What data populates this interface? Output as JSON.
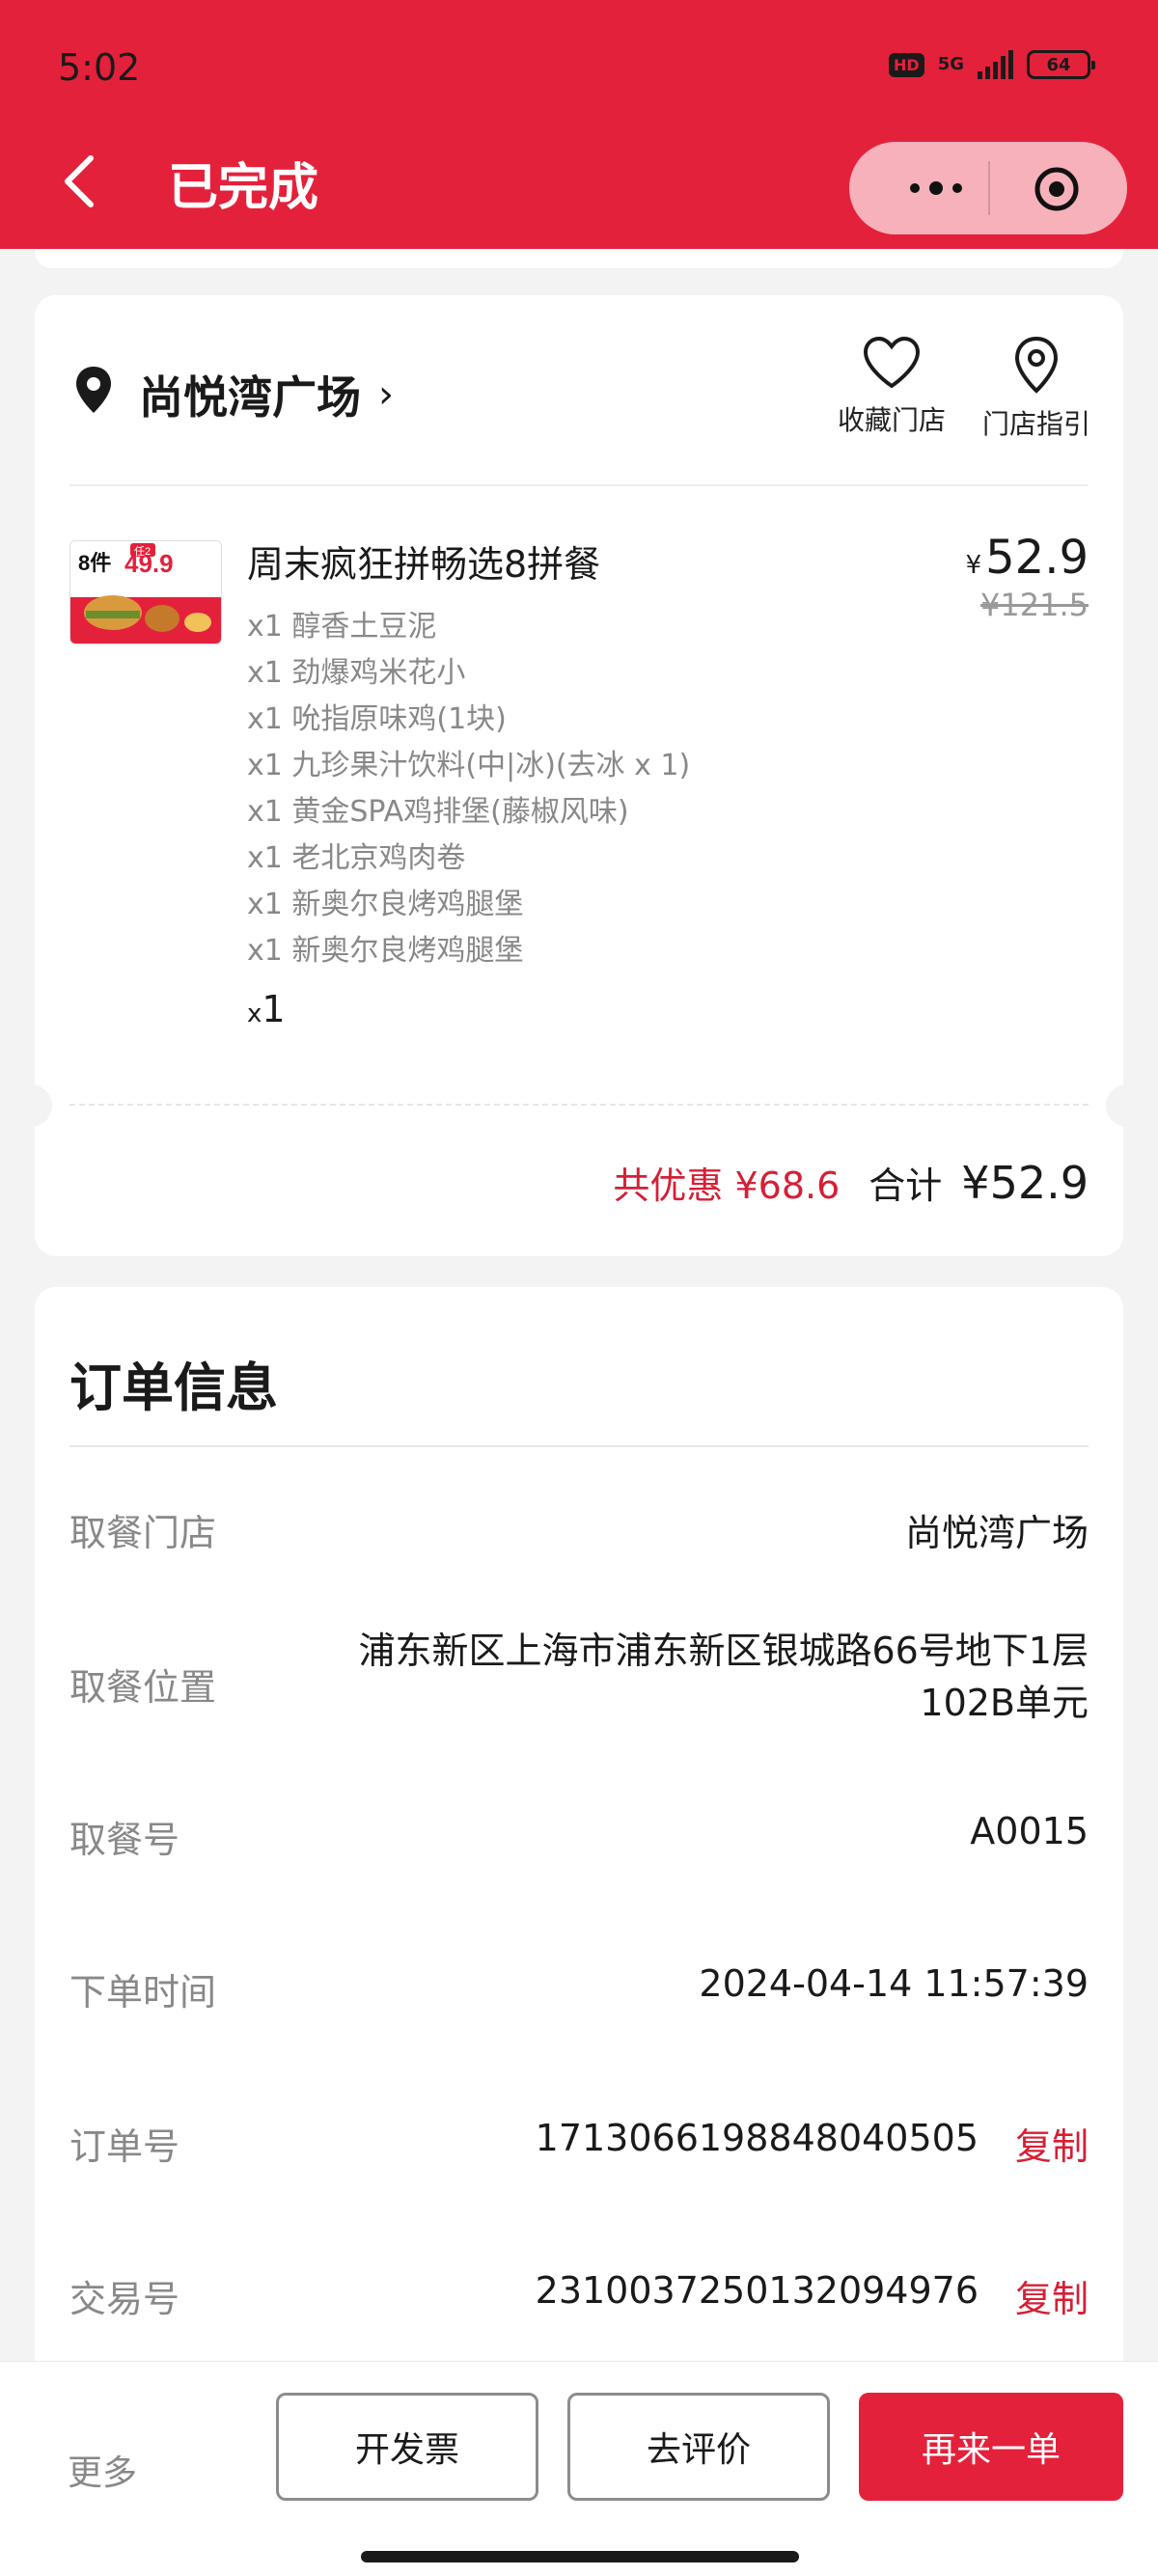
{
  "status_bar": {
    "time": "5:02",
    "hd": "HD",
    "network": "5G",
    "battery": "64"
  },
  "header": {
    "title": "已完成"
  },
  "store": {
    "name": "尚悦湾广场",
    "chevron": "›",
    "favorite_label": "收藏门店",
    "guide_label": "门店指引"
  },
  "product": {
    "thumb_text": "8件",
    "thumb_price": "49.9",
    "thumb_badge": "任2",
    "name": "周末疯狂拼畅选8拼餐",
    "currency": "¥",
    "price": "52.9",
    "original_price": "¥121.5",
    "items": [
      "x1 醇香土豆泥",
      "x1 劲爆鸡米花小",
      "x1 吮指原味鸡(1块)",
      "x1 九珍果汁饮料(中|冰)(去冰 x 1)",
      "x1 黄金SPA鸡排堡(藤椒风味)",
      "x1 老北京鸡肉卷",
      "x1 新奥尔良烤鸡腿堡",
      "x1 新奥尔良烤鸡腿堡"
    ],
    "qty_prefix": "x",
    "qty": "1"
  },
  "summary": {
    "discount": "共优惠 ¥68.6",
    "total_label": "合计",
    "total": "¥52.9"
  },
  "order_info": {
    "title": "订单信息",
    "rows": [
      {
        "label": "取餐门店",
        "value": "尚悦湾广场"
      },
      {
        "label": "取餐位置",
        "value": "浦东新区上海市浦东新区银城路66号地下1层102B单元"
      },
      {
        "label": "取餐号",
        "value": "A0015"
      },
      {
        "label": "下单时间",
        "value": "2024-04-14 11:57:39"
      },
      {
        "label": "订单号",
        "value": "1713066198848040505",
        "action": "复制"
      },
      {
        "label": "交易号",
        "value": "2310037250132094976",
        "action": "复制"
      }
    ]
  },
  "bottom_bar": {
    "more": "更多",
    "invoice": "开发票",
    "review": "去评价",
    "reorder": "再来一单"
  },
  "colors": {
    "brand": "#e4213b",
    "accent_text": "#d51f36"
  }
}
